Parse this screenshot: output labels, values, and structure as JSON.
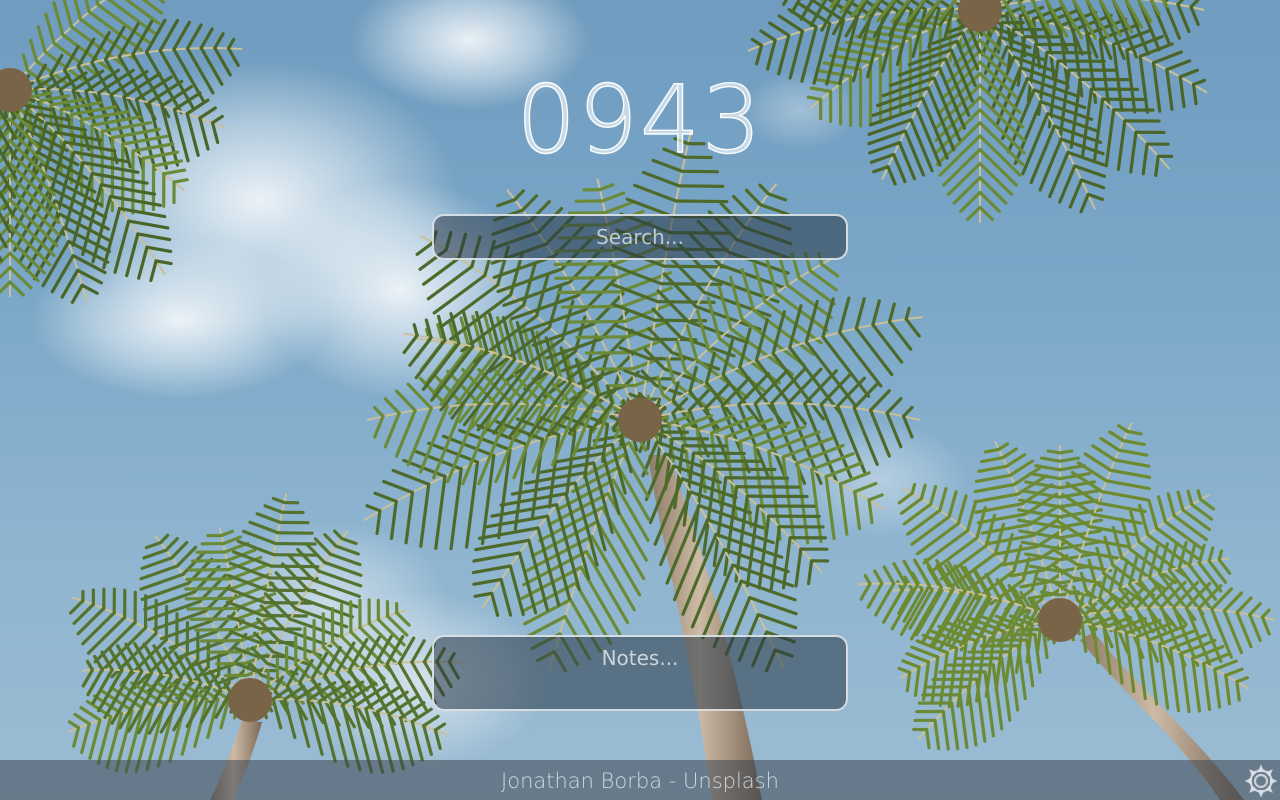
{
  "clock": {
    "time": "0943"
  },
  "search": {
    "placeholder": "Search..."
  },
  "notes": {
    "placeholder": "Notes..."
  },
  "footer": {
    "credit": "Jonathan Borba - Unsplash"
  },
  "icons": {
    "settings": "gear-icon"
  },
  "colors": {
    "sky": "#7aa7c8",
    "frond": "#4f6b2a",
    "trunk": "#b9a592",
    "panel": "#283746"
  }
}
